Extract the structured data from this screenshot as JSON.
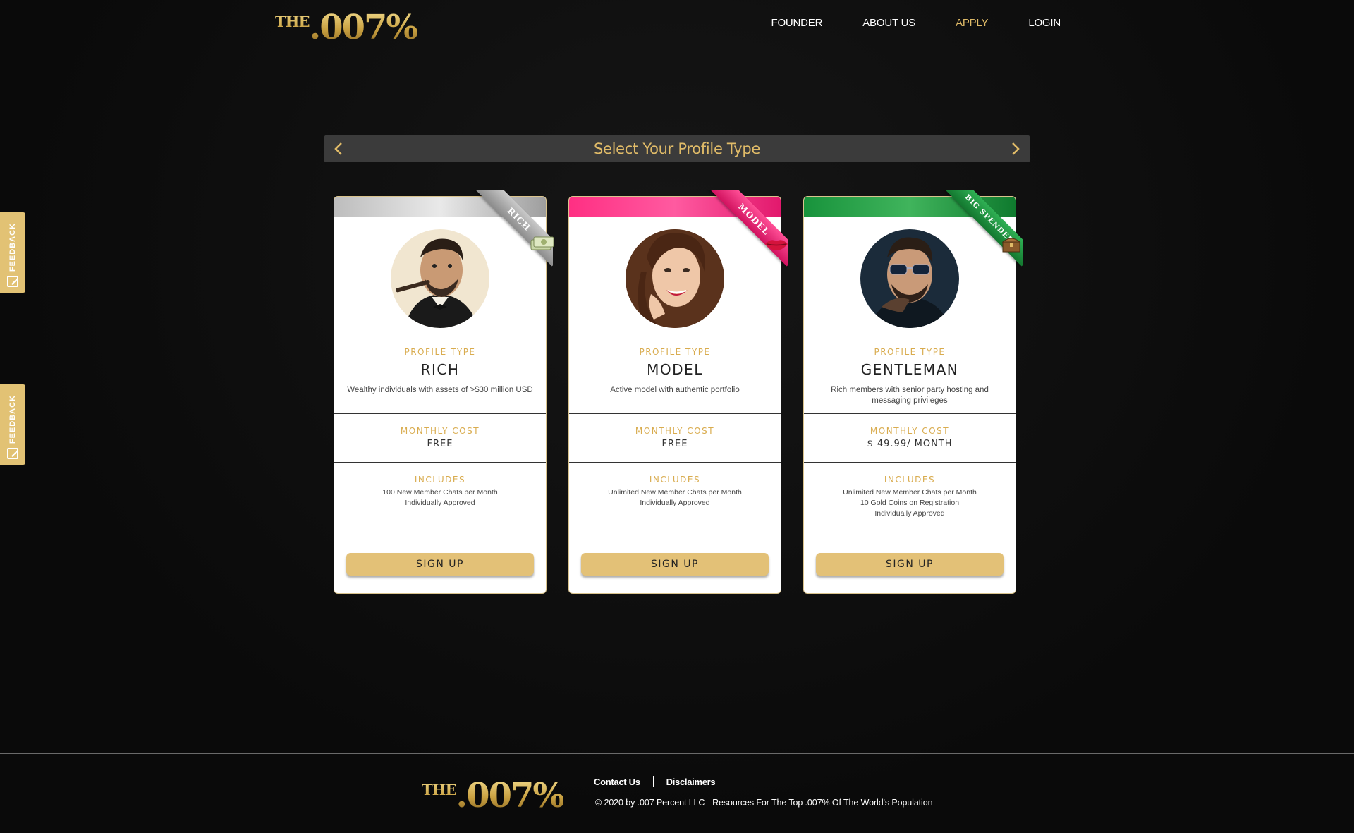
{
  "header": {
    "logo_the": "THE",
    "logo_num": ".007%",
    "nav": [
      "FOUNDER",
      "ABOUT US",
      "APPLY",
      "LOGIN"
    ],
    "active_nav": "APPLY"
  },
  "feedback": {
    "label": "FEEDBACK"
  },
  "selector": {
    "title": "Select Your Profile Type",
    "prev_icon": "chevron-left-icon",
    "next_icon": "chevron-right-icon"
  },
  "cards": [
    {
      "ribbon": "RICH",
      "color": "#b3b3b3",
      "profile_type_label": "PROFILE TYPE",
      "name": "RICH",
      "description": "Wealthy individuals with assets of >$30 million USD",
      "cost_label": "MONTHLY COST",
      "cost": "FREE",
      "includes_label": "INCLUDES",
      "includes": [
        "100 New Member Chats per Month",
        "Individually Approved"
      ],
      "button": "SIGN UP"
    },
    {
      "ribbon": "MODEL",
      "color": "#ff3c8a",
      "profile_type_label": "PROFILE TYPE",
      "name": "MODEL",
      "description": "Active model with authentic portfolio",
      "cost_label": "MONTHLY COST",
      "cost": "FREE",
      "includes_label": "INCLUDES",
      "includes": [
        "Unlimited New Member Chats per Month",
        "Individually Approved"
      ],
      "button": "SIGN UP"
    },
    {
      "ribbon": "BIG SPENDER",
      "color": "#1f9a43",
      "profile_type_label": "PROFILE TYPE",
      "name": "GENTLEMAN",
      "description": "Rich members with senior party hosting and messaging privileges",
      "cost_label": "MONTHLY COST",
      "cost": "$ 49.99/ MONTH",
      "includes_label": "INCLUDES",
      "includes": [
        "Unlimited New Member Chats per Month",
        "10 Gold Coins on Registration",
        "Individually Approved"
      ],
      "button": "SIGN UP"
    }
  ],
  "footer": {
    "logo_the": "THE",
    "logo_num": ".007%",
    "links": [
      "Contact Us",
      "Disclaimers"
    ],
    "copyright": "© 2020 by .007 Percent LLC - Resources For The Top .007% Of The World's Population"
  }
}
